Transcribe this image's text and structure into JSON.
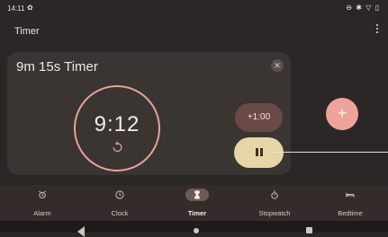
{
  "status_bar": {
    "time": "14:11",
    "gear_glyph": "✿",
    "icons": "⊖ ✱ ▽ ▯",
    "icon_names": [
      "settings-icon",
      "dnd-icon",
      "bluetooth-icon",
      "wifi-icon",
      "battery-icon"
    ]
  },
  "header": {
    "title": "Timer"
  },
  "timer_card": {
    "name": "9m 15s Timer",
    "remaining": "9:12",
    "close_glyph": "✕",
    "add_time_label": "+1:00",
    "progress_fraction": 0.995,
    "colors": {
      "ring": "#e6a197",
      "pause": "#e6d6a5",
      "add_time": "#6b4a46"
    }
  },
  "fab": {
    "label": "+",
    "color": "#f0a39b"
  },
  "bottom_nav": {
    "items": [
      {
        "label": "Alarm",
        "icon": "alarm-icon"
      },
      {
        "label": "Clock",
        "icon": "clock-icon"
      },
      {
        "label": "Timer",
        "icon": "hourglass-icon",
        "active": true
      },
      {
        "label": "Stopwatch",
        "icon": "stopwatch-icon"
      },
      {
        "label": "Bedtime",
        "icon": "bed-icon"
      }
    ]
  }
}
